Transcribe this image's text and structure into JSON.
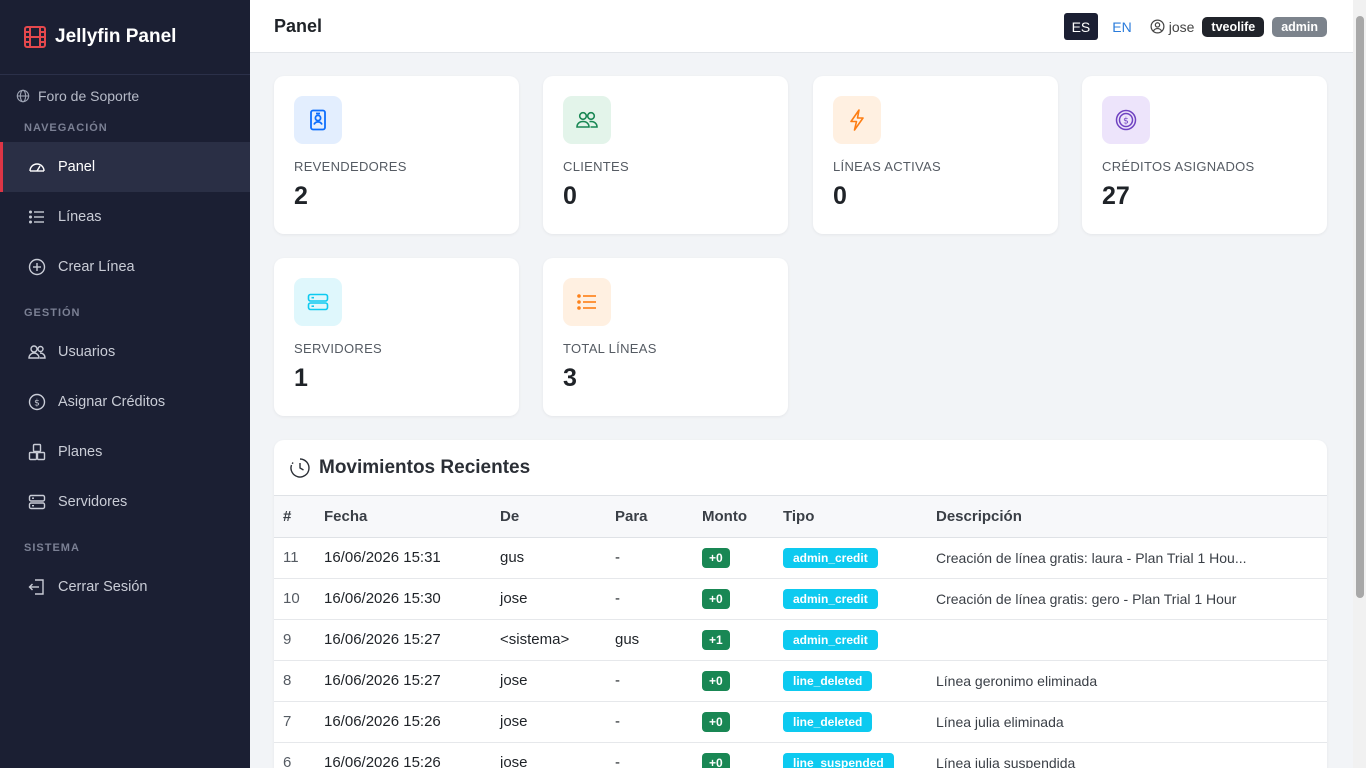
{
  "brand": {
    "title": "Jellyfin Panel"
  },
  "sidebar": {
    "support_label": "Foro de Soporte",
    "sections": {
      "nav": "NAVEGACIÓN",
      "mgmt": "GESTIÓN",
      "system": "SISTEMA"
    },
    "items": {
      "panel": "Panel",
      "lines": "Líneas",
      "create_line": "Crear Línea",
      "users": "Usuarios",
      "assign_credits": "Asignar Créditos",
      "plans": "Planes",
      "servers": "Servidores",
      "logout": "Cerrar Sesión"
    }
  },
  "header": {
    "title": "Panel",
    "lang_es": "ES",
    "lang_en": "EN",
    "user": "jose",
    "badge_1": "tveolife",
    "badge_2": "admin"
  },
  "stats": [
    {
      "label": "REVENDEDORES",
      "value": "2",
      "icon": "user-badge-icon",
      "color": "#0d6efd"
    },
    {
      "label": "CLIENTES",
      "value": "0",
      "icon": "people-icon",
      "color": "#198754"
    },
    {
      "label": "LÍNEAS ACTIVAS",
      "value": "0",
      "icon": "lightning-icon",
      "color": "#fd7e14"
    },
    {
      "label": "CRÉDITOS ASIGNADOS",
      "value": "27",
      "icon": "coin-icon",
      "color": "#6f42c1"
    },
    {
      "label": "SERVIDORES",
      "value": "1",
      "icon": "server-icon",
      "color": "#0dcaf0"
    },
    {
      "label": "TOTAL LÍNEAS",
      "value": "3",
      "icon": "list-icon",
      "color": "#fd7e14"
    }
  ],
  "movements": {
    "title": "Movimientos Recientes",
    "columns": [
      "#",
      "Fecha",
      "De",
      "Para",
      "Monto",
      "Tipo",
      "Descripción"
    ],
    "rows": [
      {
        "id": "11",
        "date": "16/06/2026 15:31",
        "from": "gus",
        "to": "-",
        "amount": "+0",
        "type": "admin_credit",
        "desc": "Creación de línea gratis: laura - Plan Trial 1 Hou..."
      },
      {
        "id": "10",
        "date": "16/06/2026 15:30",
        "from": "jose",
        "to": "-",
        "amount": "+0",
        "type": "admin_credit",
        "desc": "Creación de línea gratis: gero - Plan Trial 1 Hour"
      },
      {
        "id": "9",
        "date": "16/06/2026 15:27",
        "from": "<sistema>",
        "to": "gus",
        "amount": "+1",
        "type": "admin_credit",
        "desc": ""
      },
      {
        "id": "8",
        "date": "16/06/2026 15:27",
        "from": "jose",
        "to": "-",
        "amount": "+0",
        "type": "line_deleted",
        "desc": "Línea geronimo eliminada"
      },
      {
        "id": "7",
        "date": "16/06/2026 15:26",
        "from": "jose",
        "to": "-",
        "amount": "+0",
        "type": "line_deleted",
        "desc": "Línea julia eliminada"
      },
      {
        "id": "6",
        "date": "16/06/2026 15:26",
        "from": "jose",
        "to": "-",
        "amount": "+0",
        "type": "line_suspended",
        "desc": "Línea julia suspendida"
      }
    ]
  },
  "colors": {
    "sidebar_bg": "#1b1f33",
    "accent": "#dc3545",
    "amount_badge": "#198754",
    "type_badge": "#0dcaf0"
  }
}
